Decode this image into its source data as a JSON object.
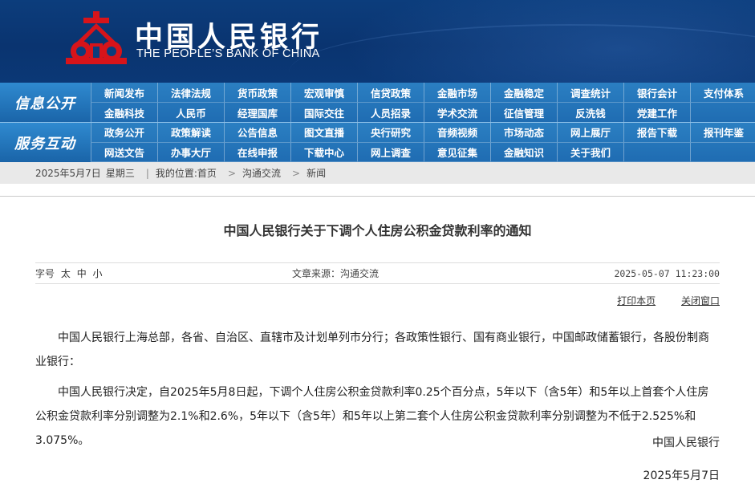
{
  "header": {
    "logo_cn": "中国人民银行",
    "logo_en": "THE PEOPLE’S BANK OF CHINA"
  },
  "nav": {
    "section1": "信息公开",
    "section2": "服务互动",
    "row1": [
      "新闻发布",
      "法律法规",
      "货币政策",
      "宏观审慎",
      "信贷政策",
      "金融市场",
      "金融稳定",
      "调查统计",
      "银行会计",
      "支付体系",
      "金融科技",
      "人民币",
      "经理国库",
      "国际交往",
      "人员招录",
      "学术交流",
      "征信管理",
      "反洗钱",
      "党建工作",
      ""
    ],
    "row2": [
      "政务公开",
      "政策解读",
      "公告信息",
      "图文直播",
      "央行研究",
      "音频视频",
      "市场动态",
      "网上展厅",
      "报告下载",
      "报刊年鉴",
      "网送文告",
      "办事大厅",
      "在线申报",
      "下载中心",
      "网上调查",
      "意见征集",
      "金融知识",
      "关于我们",
      "",
      ""
    ]
  },
  "breadcrumb": {
    "date": "2025年5月7日",
    "weekday": "星期三",
    "location_label": "我的位置:",
    "home": "首页",
    "section": "沟通交流",
    "current": "新闻"
  },
  "article": {
    "title": "中国人民银行关于下调个人住房公积金贷款利率的通知",
    "font_size_label": "字号",
    "font_large": "太",
    "font_medium": "中",
    "font_small": "小",
    "source": "文章来源：沟通交流",
    "datetime": "2025-05-07 11:23:00",
    "print_link": "打印本页",
    "close_link": "关闭窗口",
    "para1": "中国人民银行上海总部，各省、自治区、直辖市及计划单列市分行；各政策性银行、国有商业银行，中国邮政储蓄银行，各股份制商业银行：",
    "para2": "中国人民银行决定，自2025年5月8日起，下调个人住房公积金贷款利率0.25个百分点，5年以下（含5年）和5年以上首套个人住房公积金贷款利率分别调整为2.1%和2.6%，5年以下（含5年）和5年以上第二套个人住房公积金贷款利率分别调整为不低于2.525%和3.075%。",
    "signature": "中国人民银行",
    "sign_date": "2025年5月7日"
  },
  "colors": {
    "header_bg": "#0c3d7c",
    "nav_bg": "#1f6cb2",
    "logo_red": "#d7141a"
  }
}
